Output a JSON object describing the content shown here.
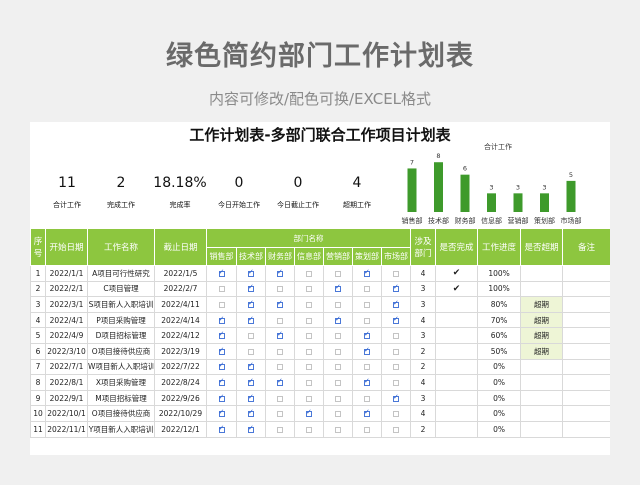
{
  "banner": {
    "title": "绿色简约部门工作计划表",
    "subtitle": "内容可修改/配色可换/EXCEL格式"
  },
  "sheet_title": "工作计划表-多部门联合工作项目计划表",
  "kpis": [
    {
      "value": "11",
      "label": "合计工作"
    },
    {
      "value": "2",
      "label": "完成工作"
    },
    {
      "value": "18.18%",
      "label": "完成率"
    },
    {
      "value": "0",
      "label": "今日开始工作"
    },
    {
      "value": "0",
      "label": "今日截止工作"
    },
    {
      "value": "4",
      "label": "超期工作"
    }
  ],
  "chart_data": {
    "type": "bar",
    "title": "合计工作",
    "categories": [
      "销售部",
      "技术部",
      "财务部",
      "信息部",
      "营销部",
      "策划部",
      "市场部"
    ],
    "values": [
      7,
      8,
      6,
      3,
      3,
      3,
      5
    ],
    "ylim": [
      0,
      9
    ],
    "grid": false,
    "colors": {
      "bar": "#3e9a2b"
    }
  },
  "table": {
    "headers": {
      "seq": "序号",
      "start": "开始日期",
      "name": "工作名称",
      "end": "截止日期",
      "dept_group": "部门名称",
      "depts": [
        "销售部",
        "技术部",
        "财务部",
        "信息部",
        "营销部",
        "策划部",
        "市场部"
      ],
      "involved": "涉及部门",
      "done": "是否完成",
      "progress": "工作进度",
      "overdue": "是否超期",
      "note": "备注"
    },
    "rows": [
      {
        "seq": "1",
        "start": "2022/1/1",
        "name": "A项目可行性研究",
        "end": "2022/1/5",
        "depts": [
          1,
          1,
          1,
          0,
          0,
          1,
          0
        ],
        "count": "4",
        "done": "✔",
        "progress": "100%",
        "overdue": ""
      },
      {
        "seq": "2",
        "start": "2022/2/1",
        "name": "C项目管理",
        "end": "2022/2/7",
        "depts": [
          0,
          1,
          0,
          0,
          1,
          0,
          1
        ],
        "count": "3",
        "done": "✔",
        "progress": "100%",
        "overdue": ""
      },
      {
        "seq": "3",
        "start": "2022/3/1",
        "name": "S项目新人入职培训",
        "end": "2022/4/11",
        "depts": [
          0,
          1,
          1,
          0,
          0,
          0,
          1
        ],
        "count": "3",
        "done": "",
        "progress": "80%",
        "overdue": "超期"
      },
      {
        "seq": "4",
        "start": "2022/4/1",
        "name": "P项目采购管理",
        "end": "2022/4/14",
        "depts": [
          1,
          1,
          0,
          0,
          1,
          0,
          1
        ],
        "count": "4",
        "done": "",
        "progress": "70%",
        "overdue": "超期"
      },
      {
        "seq": "5",
        "start": "2022/4/9",
        "name": "D项目招标管理",
        "end": "2022/4/12",
        "depts": [
          1,
          0,
          1,
          0,
          0,
          1,
          0
        ],
        "count": "3",
        "done": "",
        "progress": "60%",
        "overdue": "超期"
      },
      {
        "seq": "6",
        "start": "2022/3/10",
        "name": "O项目接待供应商",
        "end": "2022/3/19",
        "depts": [
          1,
          0,
          0,
          0,
          0,
          1,
          0
        ],
        "count": "2",
        "done": "",
        "progress": "50%",
        "overdue": "超期"
      },
      {
        "seq": "7",
        "start": "2022/7/1",
        "name": "W项目新人入职培训",
        "end": "2022/7/22",
        "depts": [
          1,
          1,
          0,
          0,
          0,
          0,
          0
        ],
        "count": "2",
        "done": "",
        "progress": "0%",
        "overdue": ""
      },
      {
        "seq": "8",
        "start": "2022/8/1",
        "name": "X项目采购管理",
        "end": "2022/8/24",
        "depts": [
          1,
          1,
          1,
          0,
          0,
          1,
          0
        ],
        "count": "4",
        "done": "",
        "progress": "0%",
        "overdue": ""
      },
      {
        "seq": "9",
        "start": "2022/9/1",
        "name": "M项目招标管理",
        "end": "2022/9/26",
        "depts": [
          1,
          1,
          0,
          0,
          0,
          0,
          1
        ],
        "count": "3",
        "done": "",
        "progress": "0%",
        "overdue": ""
      },
      {
        "seq": "10",
        "start": "2022/10/1",
        "name": "O项目接待供应商",
        "end": "2022/10/29",
        "depts": [
          1,
          1,
          0,
          1,
          0,
          1,
          0
        ],
        "count": "4",
        "done": "",
        "progress": "0%",
        "overdue": ""
      },
      {
        "seq": "11",
        "start": "2022/11/1",
        "name": "Y项目新人入职培训",
        "end": "2022/12/1",
        "depts": [
          1,
          1,
          0,
          0,
          0,
          0,
          0
        ],
        "count": "2",
        "done": "",
        "progress": "0%",
        "overdue": ""
      }
    ]
  }
}
